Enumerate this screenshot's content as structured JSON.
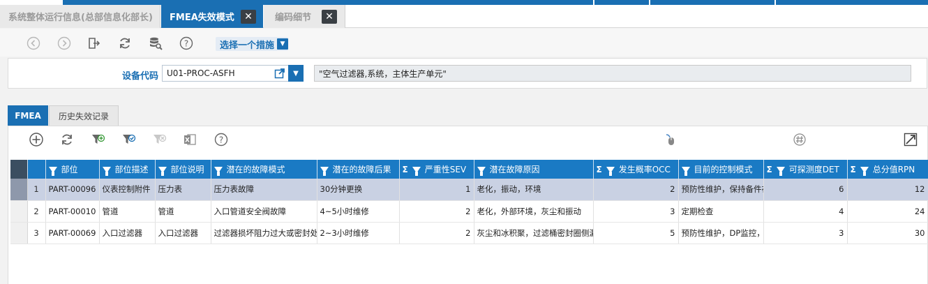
{
  "tabs": [
    {
      "label": "系统整体运行信息(总部信息化部长)",
      "active": false,
      "closable": false
    },
    {
      "label": "FMEA失效模式",
      "active": true,
      "closable": true
    },
    {
      "label": "编码细节",
      "active": false,
      "closable": true
    }
  ],
  "toolbar": {
    "icons": [
      "back-icon",
      "forward-icon",
      "export-icon",
      "refresh-icon",
      "database-search-icon",
      "help-icon"
    ],
    "action_select": "选择一个措施"
  },
  "header": {
    "device_code_label": "设备代码",
    "device_code_value": "U01-PROC-ASFH",
    "device_description": "\"空气过滤器,系统，主体生产单元\""
  },
  "inner_tabs": [
    {
      "label": "FMEA",
      "active": true
    },
    {
      "label": "历史失效记录",
      "active": false
    }
  ],
  "grid_tools": [
    "add-icon",
    "refresh-icon",
    "filter-add-icon",
    "filter-apply-icon",
    "filter-clear-icon",
    "excel-icon",
    "help-icon",
    "mouse-icon",
    "hash-icon",
    "expand-icon"
  ],
  "grid": {
    "columns": [
      {
        "label": "部位",
        "prefix": "filter"
      },
      {
        "label": "部位描述",
        "prefix": "filter"
      },
      {
        "label": "部位说明",
        "prefix": "filter"
      },
      {
        "label": "潜在的故障模式",
        "prefix": "filter"
      },
      {
        "label": "潜在的故障后果",
        "prefix": "filter"
      },
      {
        "label": "严重性SEV",
        "prefix": "sum-filter"
      },
      {
        "label": "潜在故障原因",
        "prefix": "filter"
      },
      {
        "label": "发生概率OCC",
        "prefix": "sum-filter"
      },
      {
        "label": "目前的控制模式",
        "prefix": "filter"
      },
      {
        "label": "可探测度DET",
        "prefix": "sum-filter"
      },
      {
        "label": "总分值RPN",
        "prefix": "sum-filter"
      }
    ],
    "sum_symbol": "Σ",
    "rows": [
      {
        "n": "1",
        "part": "PART-00096",
        "desc": "仪表控制附件",
        "note": "压力表",
        "mode": "压力表故障",
        "effect": "30分钟更换",
        "sev": "1",
        "cause": "老化，振动，环境",
        "occ": "2",
        "control": "预防性维护，保持备件在",
        "det": "6",
        "rpn": "12",
        "selected": true
      },
      {
        "n": "2",
        "part": "PART-00010",
        "desc": "管道",
        "note": "管道",
        "mode": "入口管道安全阀故障",
        "effect": "4~5小时维修",
        "sev": "2",
        "cause": "老化，外部环境，灰尘和振动",
        "occ": "3",
        "control": "定期检查",
        "det": "4",
        "rpn": "24",
        "selected": false
      },
      {
        "n": "3",
        "part": "PART-00069",
        "desc": "入口过滤器",
        "note": "入口过滤器",
        "mode": "过滤器损坏阻力过大或密封处泄",
        "effect": "2~3小时维修",
        "sev": "2",
        "cause": "灰尘和冰积聚，过滤桶密封圈侧漏",
        "occ": "5",
        "control": "预防性维护，DP监控，使",
        "det": "3",
        "rpn": "30",
        "selected": false
      }
    ]
  },
  "colors": {
    "accent": "#1a6fb3",
    "header": "#1a7ac4",
    "selected_row": "#c9d1e3"
  }
}
